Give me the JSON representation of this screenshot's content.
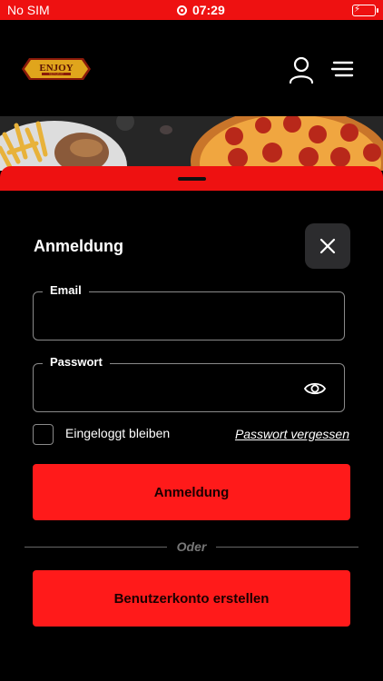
{
  "status_bar": {
    "carrier": "No SIM",
    "time": "07:29",
    "battery_charging_symbol": "⚡"
  },
  "header": {
    "logo_text": "ENJOY",
    "logo_subtext": "RESTAURANT",
    "user_icon": "user-icon",
    "menu_icon": "menu-icon"
  },
  "login": {
    "title": "Anmeldung",
    "email_label": "Email",
    "email_value": "",
    "password_label": "Passwort",
    "password_value": "",
    "remember_label": "Eingeloggt bleiben",
    "remember_checked": false,
    "forgot_label": "Passwort vergessen",
    "login_button": "Anmeldung",
    "divider_text": "Oder",
    "register_button": "Benutzerkonto erstellen"
  },
  "colors": {
    "accent": "#ff1a1a",
    "status_bar": "#ee1111",
    "background": "#000000",
    "close_button_bg": "#2c2c2e",
    "battery": "#4cd964"
  }
}
